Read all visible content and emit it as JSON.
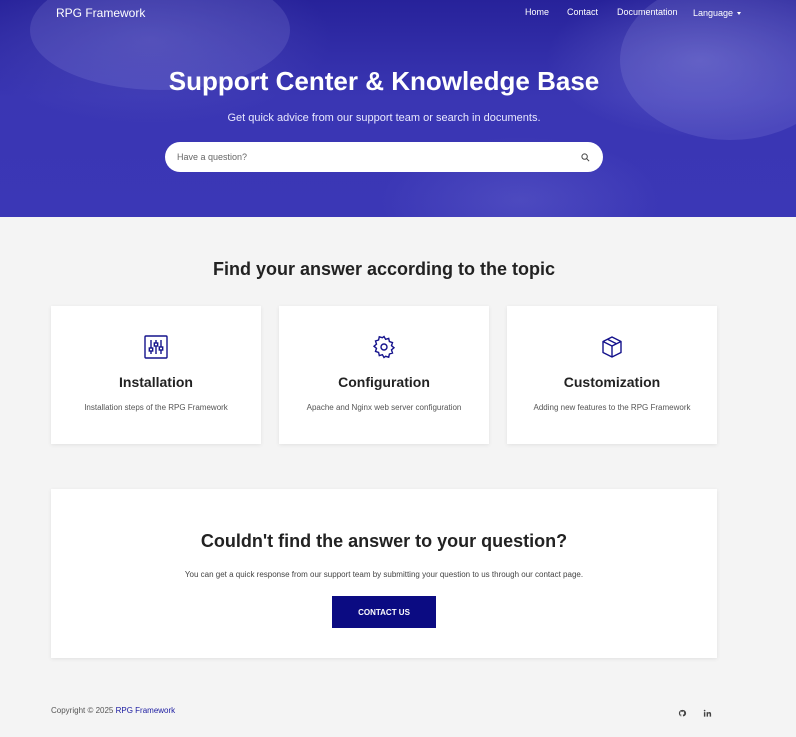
{
  "header": {
    "brand": "RPG Framework",
    "nav": [
      {
        "label": "Home"
      },
      {
        "label": "Contact"
      },
      {
        "label": "Documentation"
      },
      {
        "label": "Language"
      }
    ]
  },
  "hero": {
    "title": "Support Center & Knowledge Base",
    "subtitle": "Get quick advice from our support team or search in documents.",
    "search_placeholder": "Have a question?",
    "search_icon": "search-icon"
  },
  "topics": {
    "title": "Find your answer according to the topic",
    "cards": [
      {
        "icon": "sliders-icon",
        "title": "Installation",
        "description": "Installation steps of the RPG Framework"
      },
      {
        "icon": "gear-icon",
        "title": "Configuration",
        "description": "Apache and Nginx web server configuration"
      },
      {
        "icon": "box-icon",
        "title": "Customization",
        "description": "Adding new features to the RPG Framework"
      }
    ]
  },
  "cta": {
    "title": "Couldn't find the answer to your question?",
    "text": "You can get a quick response from our support team by submitting your question to us through our contact page.",
    "button": "CONTACT US"
  },
  "footer": {
    "copyright": "Copyright © 2025",
    "link": "RPG Framework",
    "social": [
      "github-icon",
      "linkedin-icon"
    ]
  },
  "colors": {
    "hero": "#3a36b3",
    "accent": "#0b0b82",
    "background": "#f4f4f4"
  }
}
